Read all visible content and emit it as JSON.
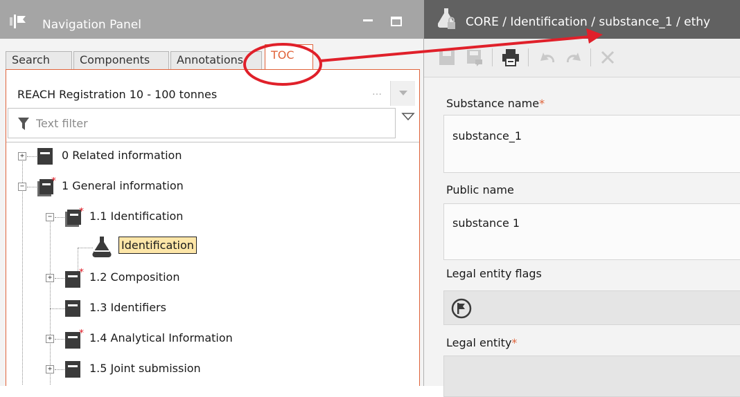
{
  "left_panel": {
    "title": "Navigation Panel",
    "tabs": [
      {
        "label": "Search"
      },
      {
        "label": "Components"
      },
      {
        "label": "Annotations"
      },
      {
        "label": "TOC"
      }
    ],
    "template_select": "REACH Registration 10 - 100 tonnes",
    "filter_placeholder": "Text filter",
    "tree": [
      {
        "label": "0 Related information"
      },
      {
        "label": "1 General information"
      },
      {
        "label": "1.1 Identification"
      },
      {
        "label": "Identification"
      },
      {
        "label": "1.2 Composition"
      },
      {
        "label": "1.3 Identifiers"
      },
      {
        "label": "1.4 Analytical Information"
      },
      {
        "label": "1.5 Joint submission"
      }
    ]
  },
  "right_panel": {
    "title": "CORE / Identification / substance_1 / ethy",
    "fields": {
      "substance_name": {
        "label": "Substance name",
        "value": "substance_1"
      },
      "public_name": {
        "label": "Public name",
        "value": "substance 1"
      },
      "legal_entity_flags": {
        "label": "Legal entity flags"
      },
      "legal_entity": {
        "label": "Legal entity"
      }
    },
    "required_marker": "*"
  },
  "colors": {
    "accent": "#e0633a",
    "annotation_red": "#e0202a",
    "header_gray": "#a5a5a5",
    "header_dark": "#616161",
    "selection_fill": "#fde6a8"
  }
}
